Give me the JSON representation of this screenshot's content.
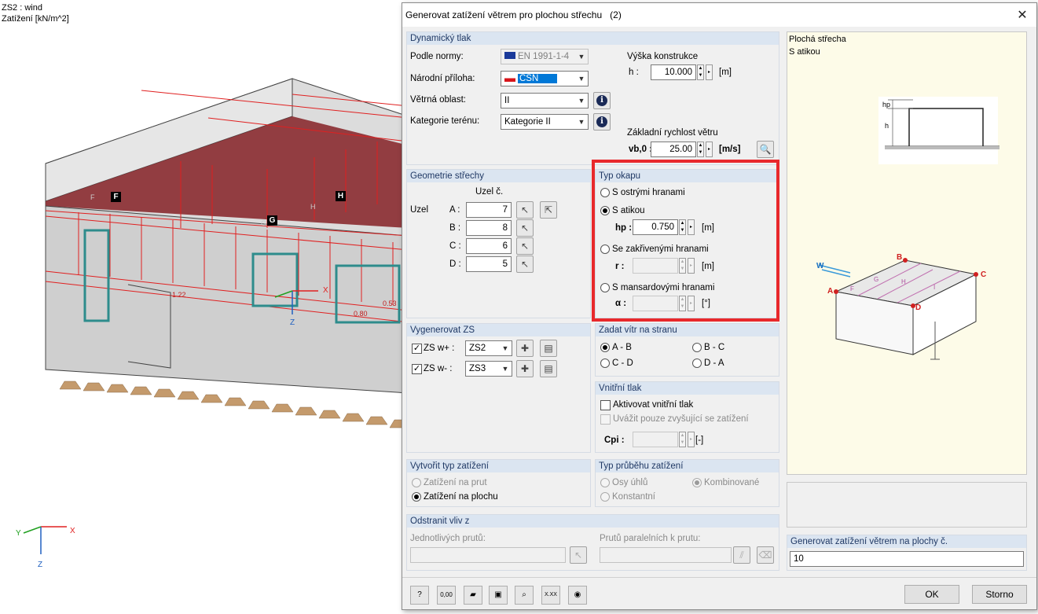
{
  "viewport": {
    "line1": "ZS2 : wind",
    "line2": "Zatížení [kN/m^2]",
    "zone_F": "F",
    "zone_H": "H",
    "zone_G": "G",
    "label_F": "F",
    "label_H": "H",
    "label_G": "G",
    "axis_x": "X",
    "axis_z": "Z",
    "corner_x": "X",
    "corner_y": "Y",
    "corner_z": "Z",
    "val1": "1.22",
    "val2": "0.80",
    "val3": "0.53"
  },
  "dialog": {
    "title": "Generovat zatížení větrem pro plochou střechu",
    "count": "(2)",
    "dyn": {
      "header": "Dynamický tlak",
      "norm_label": "Podle normy:",
      "norm_value": "EN 1991-1-4",
      "annex_label": "Národní příloha:",
      "annex_value": "ČSN",
      "zone_label": "Větrná oblast:",
      "zone_value": "II",
      "terrain_label": "Kategorie terénu:",
      "terrain_value": "Kategorie II",
      "height_title": "Výška konstrukce",
      "h_label": "h :",
      "h_value": "10.000",
      "h_unit": "[m]",
      "speed_title": "Základní rychlost větru",
      "vb_label": "vb,0 :",
      "vb_value": "25.00",
      "vb_unit": "[m/s]"
    },
    "geom": {
      "header": "Geometrie střechy",
      "col_label": "Uzel č.",
      "uzel": "Uzel",
      "nodes": [
        {
          "label": "A :",
          "value": "7"
        },
        {
          "label": "B :",
          "value": "8"
        },
        {
          "label": "C :",
          "value": "6"
        },
        {
          "label": "D :",
          "value": "5"
        }
      ]
    },
    "eave": {
      "header": "Typ okapu",
      "opt1": "S ostrými hranami",
      "opt2": "S atikou",
      "hp_label": "hp :",
      "hp_value": "0.750",
      "hp_unit": "[m]",
      "opt3": "Se zakřivenými hranami",
      "r_label": "r :",
      "r_unit": "[m]",
      "opt4": "S mansardovými hranami",
      "a_label": "α :",
      "a_unit": "[°]"
    },
    "gen": {
      "header": "Vygenerovat ZS",
      "w1_label": "ZS w+ :",
      "w1_value": "ZS2",
      "w2_label": "ZS w- :",
      "w2_value": "ZS3"
    },
    "side": {
      "header": "Zadat vítr na stranu",
      "ab": "A - B",
      "bc": "B - C",
      "cd": "C - D",
      "da": "D - A"
    },
    "inner": {
      "header": "Vnitřní tlak",
      "activate": "Aktivovat vnitřní tlak",
      "only_inc": "Uvážit pouze zvyšující se zatížení",
      "cpi_label": "Cpi :",
      "cpi_unit": "[-]"
    },
    "create": {
      "header": "Vytvořit typ zatížení",
      "opt1": "Zatížení na prut",
      "opt2": "Zatížení na plochu"
    },
    "course": {
      "header": "Typ průběhu zatížení",
      "opt1": "Osy úhlů",
      "opt2": "Kombinované",
      "opt3": "Konstantní"
    },
    "remove": {
      "header": "Odstranit vliv z",
      "single": "Jednotlivých prutů:",
      "parallel": "Prutů paralelních k prutu:"
    },
    "preview": {
      "line1": "Plochá střecha",
      "line2": "S atikou",
      "hp": "hp",
      "h": "h",
      "w": "W",
      "A": "A",
      "B": "B",
      "C": "C",
      "D": "D",
      "F": "F",
      "G": "G",
      "H": "H",
      "I": "I"
    },
    "surfaces": {
      "label": "Generovat zatížení větrem na plochy č.",
      "value": "10"
    },
    "ok": "OK",
    "cancel": "Storno",
    "tb_zero": "0,00",
    "tb_xxx": "X.XX"
  },
  "colors": {
    "accent_red": "#e8282b",
    "group_header": "#dbe5f1",
    "preview_bg": "#fdfbe8"
  }
}
